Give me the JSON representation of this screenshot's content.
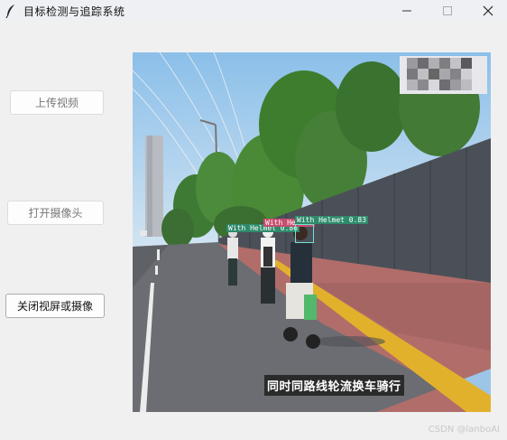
{
  "window": {
    "title": "目标检测与追踪系统",
    "icon": "feather-icon",
    "controls": [
      "minimize-icon",
      "maximize-icon",
      "close-icon"
    ]
  },
  "buttons": {
    "upload_video": "上传视频",
    "open_camera": "打开摄像头",
    "close_view": "关闭视屏或摄像"
  },
  "video": {
    "detections": [
      {
        "label": "With Helmet 0.86"
      },
      {
        "label": "With Helmet"
      },
      {
        "label": "With Helmet 0.83"
      }
    ],
    "subtitle": "同时同路线轮流换车骑行"
  },
  "watermark": "CSDN @lanboAI",
  "colors": {
    "label_green": "#2e8a6b",
    "label_pink": "#c84d6e",
    "box_cyan": "#74e0d0"
  }
}
